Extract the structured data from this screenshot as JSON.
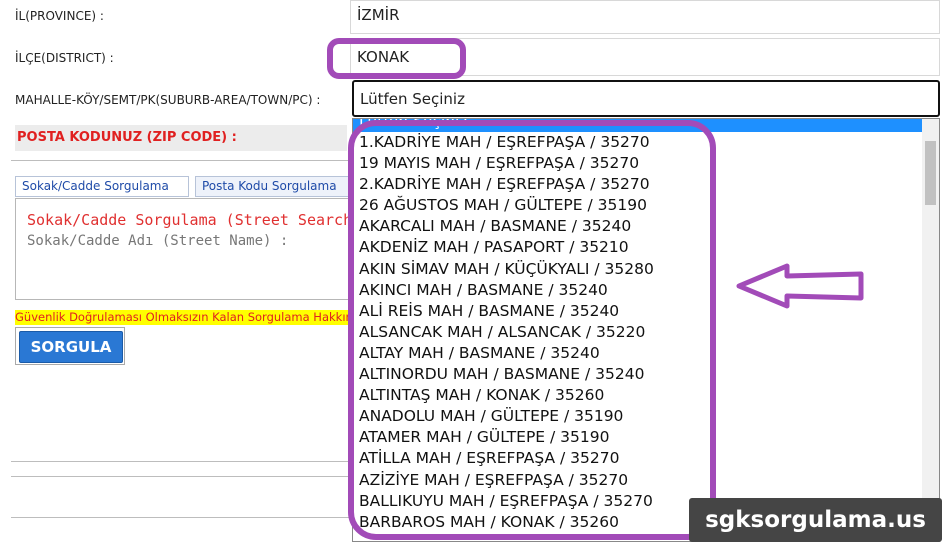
{
  "form": {
    "province_label": "İL(PROVINCE) :",
    "province_value": "İZMİR",
    "district_label": "İLÇE(DISTRICT) :",
    "district_value": "KONAK",
    "suburb_label": "MAHALLE-KÖY/SEMT/PK(SUBURB-AREA/TOWN/PC) :",
    "suburb_selected": "Lütfen Seçiniz",
    "zip_label": "POSTA KODUNUZ (ZIP CODE) :"
  },
  "tabs": [
    {
      "label": "Sokak/Cadde Sorgulama"
    },
    {
      "label": "Posta Kodu Sorgulama"
    }
  ],
  "panel": {
    "title": "Sokak/Cadde Sorgulama (Street Search)",
    "subtitle": "Sokak/Cadde Adı (Street Name) :"
  },
  "warning": "Güvenlik Doğrulaması Olmaksızın Kalan Sorgulama Hakkınız",
  "query_button": "SORGULA",
  "dropdown": {
    "options": [
      "Lütfen Seçiniz",
      "1.KADRİYE MAH / EŞREFPAŞA / 35270",
      "19 MAYIS MAH / EŞREFPAŞA / 35270",
      "2.KADRİYE MAH / EŞREFPAŞA / 35270",
      "26 AĞUSTOS MAH / GÜLTEPE / 35190",
      "AKARCALI MAH / BASMANE / 35240",
      "AKDENİZ MAH / PASAPORT / 35210",
      "AKIN SİMAV MAH / KÜÇÜKYALI / 35280",
      "AKINCI MAH / BASMANE / 35240",
      "ALİ REİS MAH / BASMANE / 35240",
      "ALSANCAK MAH / ALSANCAK / 35220",
      "ALTAY MAH / BASMANE / 35240",
      "ALTINORDU MAH / BASMANE / 35240",
      "ALTINTAŞ MAH / KONAK / 35260",
      "ANADOLU MAH / GÜLTEPE / 35190",
      "ATAMER MAH / GÜLTEPE / 35190",
      "ATİLLA MAH / EŞREFPAŞA / 35270",
      "AZİZİYE MAH / EŞREFPAŞA / 35270",
      "BALLIKUYU MAH / EŞREFPAŞA / 35270",
      "BARBAROS MAH / KONAK / 35260"
    ]
  },
  "annotation": {
    "color": "#a24bb8",
    "arrow_icon": "arrow-left-icon"
  },
  "watermark": "sgksorgulama.us"
}
